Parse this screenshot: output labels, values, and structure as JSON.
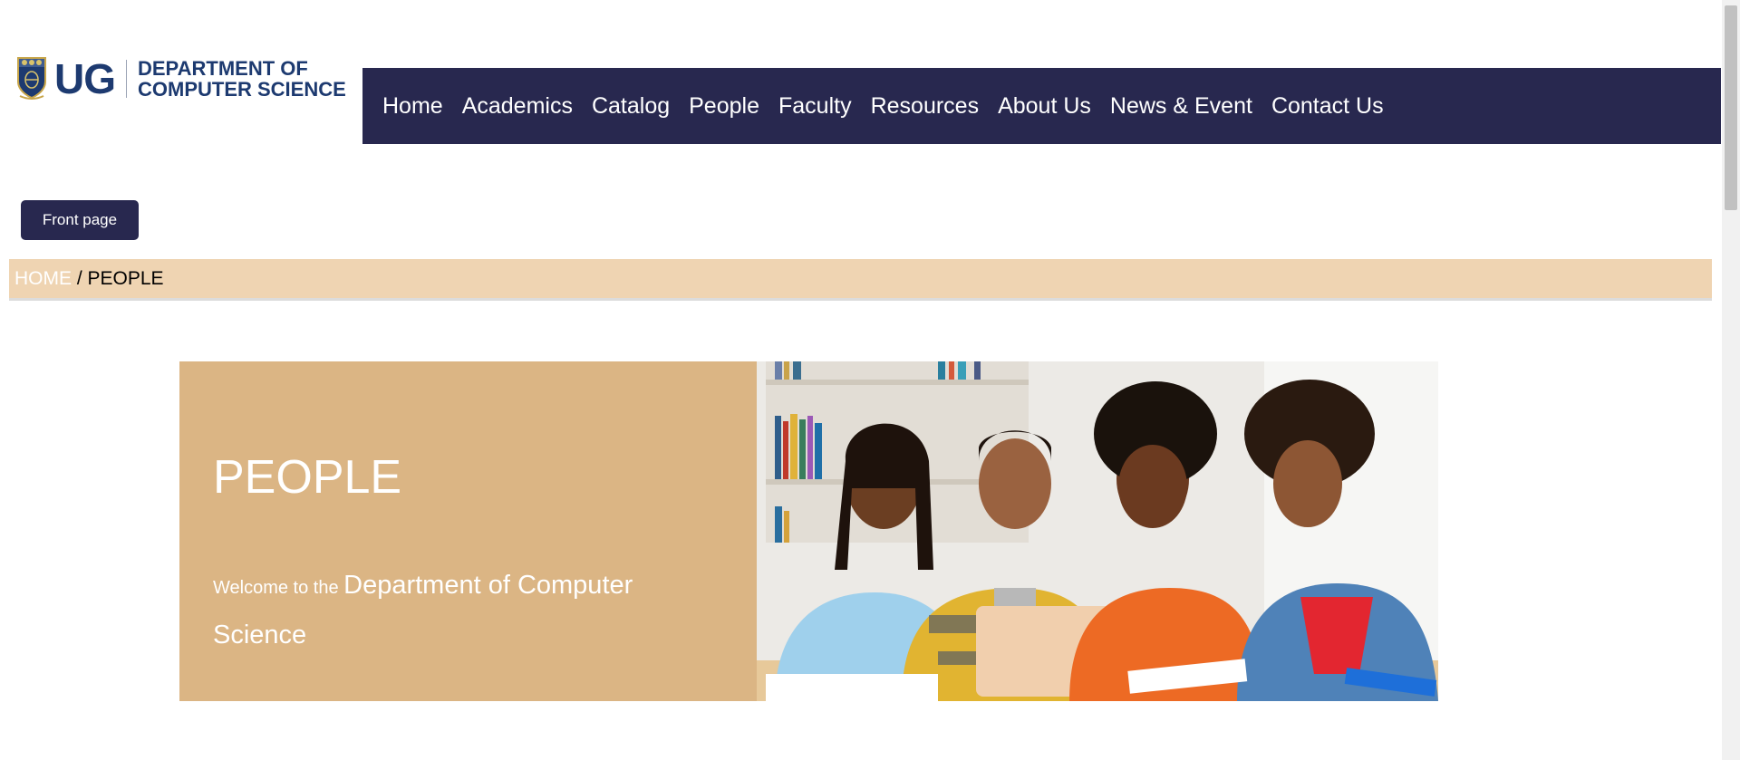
{
  "logo": {
    "ug": "UG",
    "dept_line1": "DEPARTMENT OF",
    "dept_line2": "COMPUTER SCIENCE",
    "icon": "university-crest-icon"
  },
  "nav": {
    "items": [
      "Home",
      "Academics",
      "Catalog",
      "People",
      "Faculty",
      "Resources",
      "About Us",
      "News & Event",
      "Contact Us"
    ]
  },
  "front_button": "Front page",
  "breadcrumb": {
    "home": "HOME",
    "separator": " / ",
    "current": "PEOPLE"
  },
  "hero": {
    "title": "PEOPLE",
    "subtitle_small": "Welcome to the ",
    "subtitle_big": "Department of Computer Science",
    "photo": "students-group-photo"
  },
  "colors": {
    "nav_bg": "#28284f",
    "breadcrumb_bg": "#efd4b2",
    "hero_bg": "#dbb584",
    "logo_blue": "#1d3a70"
  }
}
